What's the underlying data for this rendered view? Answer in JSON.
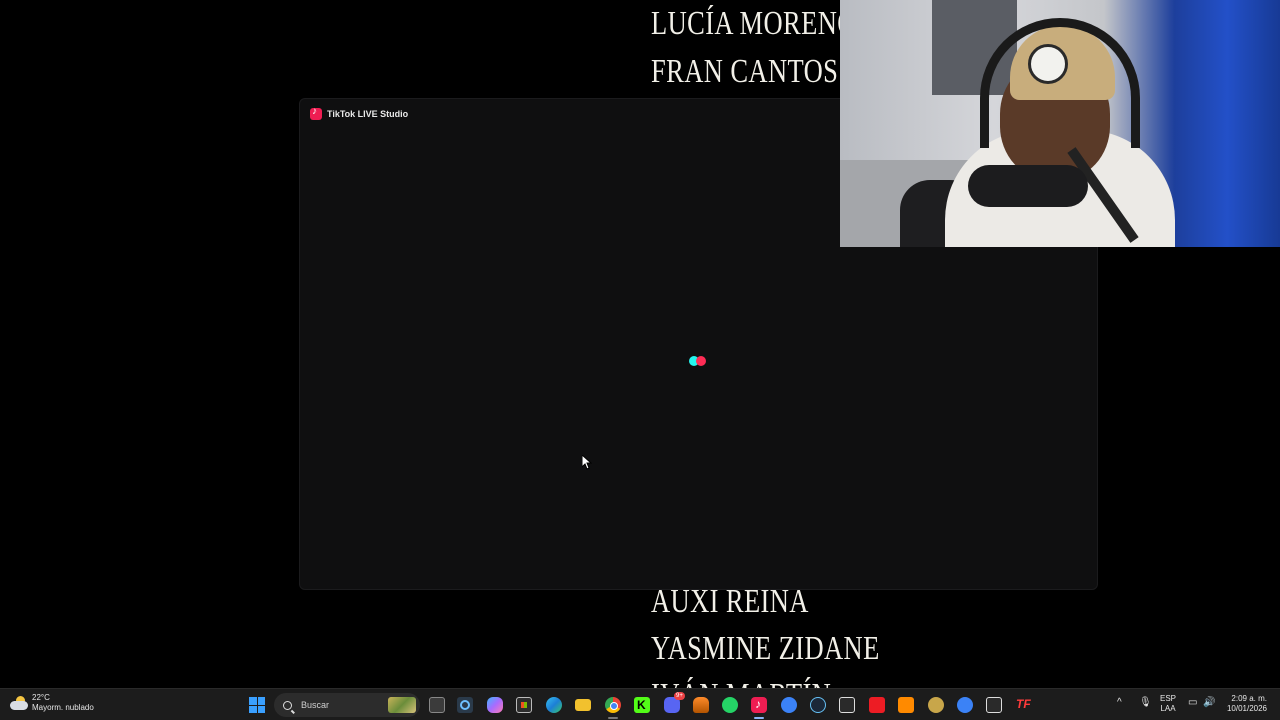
{
  "background_credits": [
    "LUCÍA MORENO",
    "FRAN CANTOS",
    "AUXI REINA",
    "YASMINE ZIDANE",
    "IVÁN MARTÍN"
  ],
  "window": {
    "title": "TikTok LIVE Studio",
    "logo_icon": "tiktok-logo-icon",
    "status": "loading"
  },
  "colors": {
    "loader_cyan": "#25f4ee",
    "loader_pink": "#fe2c55",
    "tiktok_red": "#ee1d52",
    "taskbar_bg": "#1c1c1c"
  },
  "taskbar": {
    "weather": {
      "temp": "22°C",
      "condition": "Mayorm. nublado"
    },
    "search_placeholder": "Buscar",
    "apps": [
      "task-view-icon",
      "snipping-tool-icon",
      "copilot-icon",
      "microsoft-store-icon",
      "edge-icon",
      "file-explorer-icon",
      "chrome-icon",
      "kick-icon",
      "discord-icon",
      "fl-studio-icon",
      "whatsapp-icon",
      "tiktok-live-studio-icon",
      "app-icon",
      "steam-icon",
      "epic-games-icon",
      "amd-icon",
      "launcher-icon",
      "game-icon",
      "app-icon-2",
      "epic-games-2-icon",
      "tf-icon"
    ],
    "language": {
      "line1": "ESP",
      "line2": "LAA"
    },
    "clock": {
      "time": "2:09 a. m.",
      "date": "10/01/2026"
    },
    "discord_badge": "9+"
  }
}
